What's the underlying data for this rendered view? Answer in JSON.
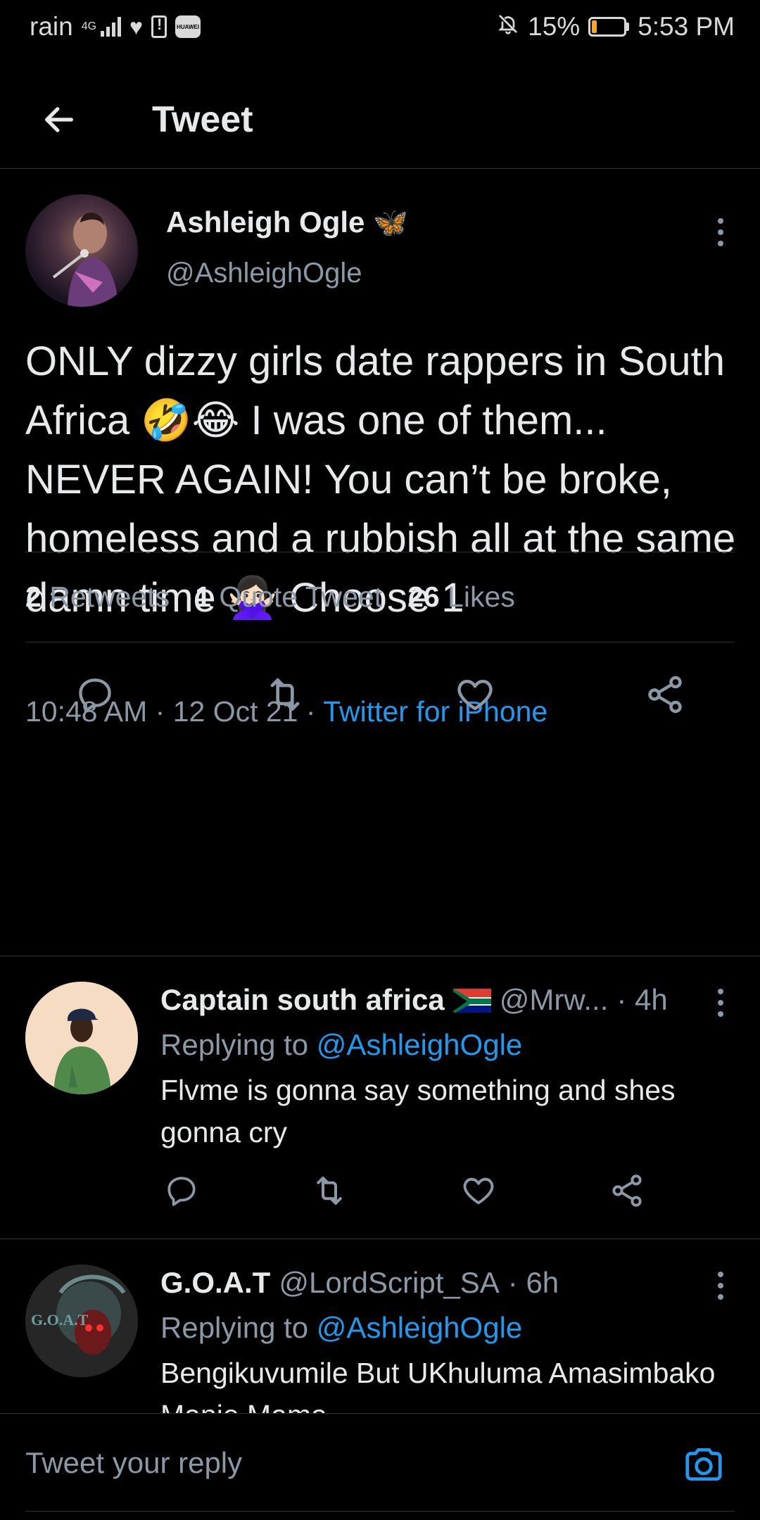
{
  "status_bar": {
    "carrier": "rain",
    "network": "4G",
    "battery_percent": "15%",
    "battery_level": 0.15,
    "time": "5:53 PM",
    "brand_badge": "HUAWEI"
  },
  "header": {
    "title": "Tweet",
    "back_icon": "arrow-left-icon"
  },
  "main_tweet": {
    "author_name": "Ashleigh Ogle",
    "author_badge": "🦋",
    "author_handle": "@AshleighOgle",
    "text": "ONLY dizzy girls date rappers in South Africa 🤣😂 I was one of them... NEVER AGAIN! You can’t be broke, homeless and a rubbish all at the same damn time 🙅🏻‍♀️ Choose 1",
    "time": "10:48 AM",
    "date": "12 Oct 21",
    "separator": "·",
    "source": "Twitter for iPhone",
    "stats": {
      "retweets_count": "2",
      "retweets_label": "Retweets",
      "quotes_count": "1",
      "quotes_label": "Quote Tweet",
      "likes_count": "26",
      "likes_label": "Likes"
    },
    "actions": [
      "reply-icon",
      "retweet-icon",
      "like-icon",
      "share-icon"
    ]
  },
  "replies": [
    {
      "name": "Captain south africa",
      "flag": "🇿🇦",
      "handle": "@Mrw...",
      "time": "· 4h",
      "replying_prefix": "Replying to",
      "replying_to": "@AshleighOgle",
      "text": "Flvme is gonna say something and shes gonna cry"
    },
    {
      "name": "G.O.A.T",
      "handle": "@LordScript_SA",
      "time": "· 6h",
      "replying_prefix": "Replying to",
      "replying_to": "@AshleighOgle",
      "text": "Bengikuvumile But UKhuluma Amasimbako Manje Mama",
      "avatar_text": "G.O.A.T"
    }
  ],
  "composer": {
    "placeholder": "Tweet your reply",
    "camera_icon": "camera-icon"
  },
  "colors": {
    "background": "#000000",
    "accent": "#1d9bf0",
    "secondary_text": "#8b98a5",
    "battery_low": "#f5a623"
  }
}
